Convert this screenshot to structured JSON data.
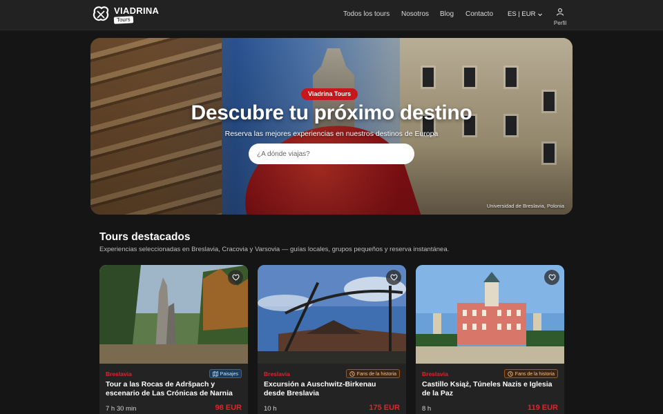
{
  "header": {
    "brand": "VIADRINA",
    "brand_sub": "Tours",
    "nav": [
      "Todos los tours",
      "Nosotros",
      "Blog",
      "Contacto"
    ],
    "lang": "ES | EUR",
    "profile_label": "Perfil"
  },
  "hero": {
    "badge": "Viadrina Tours",
    "title": "Descubre tu próximo destino",
    "subtitle": "Reserva las mejores experiencias en nuestros destinos de Europa",
    "search_placeholder": "¿A dónde viajas?",
    "caption": "Universidad de Breslavia, Polonia"
  },
  "featured": {
    "title": "Tours destacados",
    "subtitle": "Experiencias seleccionadas en Breslavia, Cracovia y Varsovia — guías locales, grupos pequeños y reserva instantánea.",
    "cards": [
      {
        "city": "Breslavia",
        "tag": "Paisajes",
        "tag_icon": "map-icon",
        "title": "Tour a las Rocas de Adršpach y escenario de Las Crónicas de Narnia",
        "duration": "7 h 30 min",
        "price": "98 EUR"
      },
      {
        "city": "Breslavia",
        "tag": "Fans de la historia",
        "tag_icon": "clock-icon",
        "title": "Excursión a Auschwitz-Birkenau desde Breslavia",
        "duration": "10 h",
        "price": "175 EUR"
      },
      {
        "city": "Breslavia",
        "tag": "Fans de la historia",
        "tag_icon": "clock-icon",
        "title": "Castillo Książ, Túneles Nazis e Iglesia de la Paz",
        "duration": "8 h",
        "price": "119 EUR"
      }
    ]
  },
  "colors": {
    "accent_red": "#e0242b",
    "badge_red": "#c8161d",
    "background": "#151515",
    "header": "#222222",
    "card": "#232323"
  }
}
